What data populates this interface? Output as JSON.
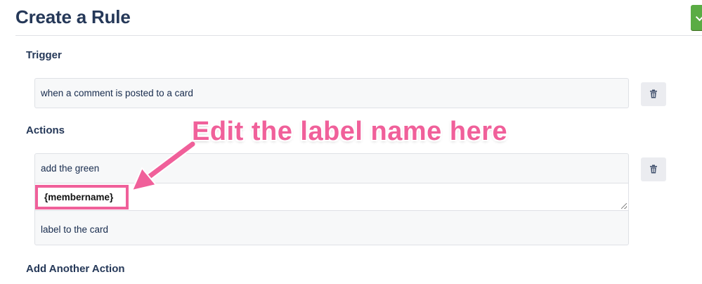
{
  "header": {
    "title": "Create a Rule"
  },
  "trigger": {
    "heading": "Trigger",
    "text": "when a comment is posted to a card"
  },
  "actions": {
    "heading": "Actions",
    "line1": "add the green",
    "input_value": "{membername}",
    "line3": "label to the card"
  },
  "add_another": {
    "heading": "Add Another Action"
  },
  "annotation": {
    "text": "Edit the label name here"
  },
  "icons": {
    "delete": "trash-icon",
    "corner": "check-icon"
  },
  "colors": {
    "annotation": "#f0609a",
    "corner_button": "#5aac44",
    "heading": "#253858"
  }
}
